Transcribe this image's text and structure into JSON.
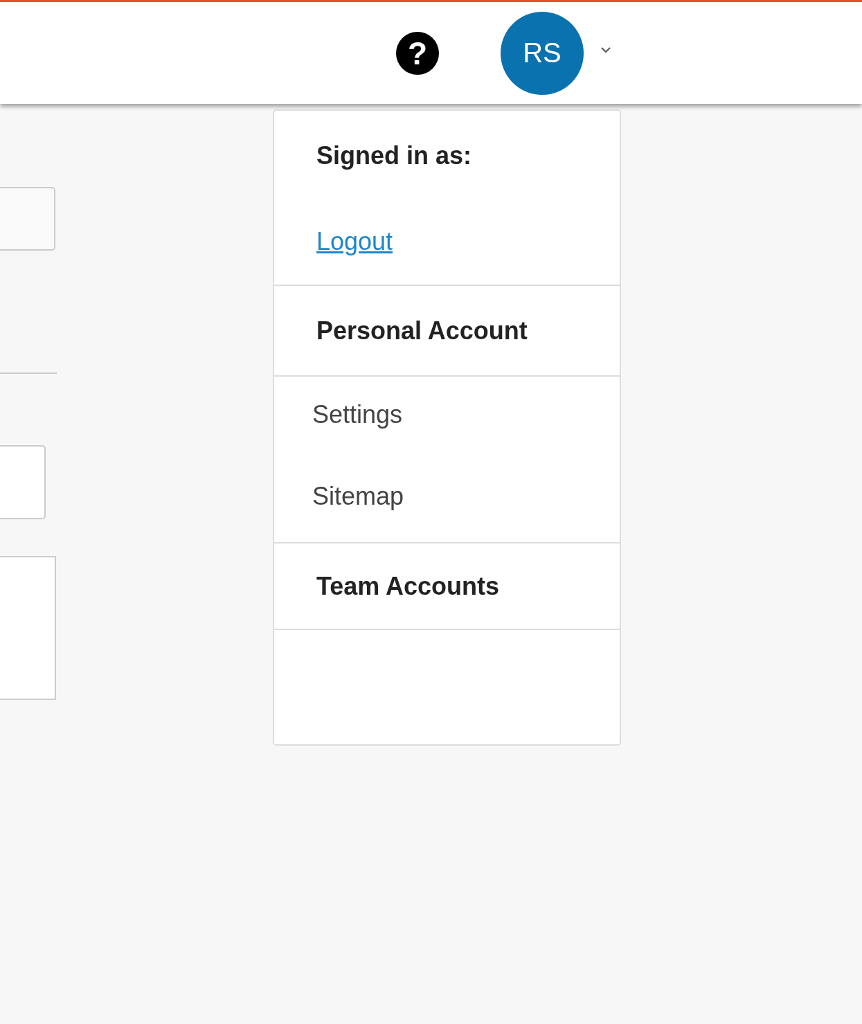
{
  "header": {
    "help": "?",
    "avatar": {
      "initials": "RS"
    }
  },
  "form": {
    "fields": [
      {
        "kind": "input"
      },
      {
        "kind": "divider"
      },
      {
        "kind": "input"
      },
      {
        "kind": "textarea"
      }
    ]
  },
  "user_menu": {
    "expanded": true,
    "sections": [
      {
        "items": [
          {
            "kind": "heading",
            "label": "Signed in as:"
          },
          {
            "kind": "link",
            "label": "Logout"
          }
        ]
      },
      {
        "items": [
          {
            "kind": "heading",
            "label": "Personal Account"
          }
        ]
      },
      {
        "items": [
          {
            "kind": "item",
            "label": "Settings"
          },
          {
            "kind": "item",
            "label": "Sitemap"
          }
        ]
      },
      {
        "items": [
          {
            "kind": "heading",
            "label": "Team Accounts"
          }
        ]
      }
    ]
  }
}
